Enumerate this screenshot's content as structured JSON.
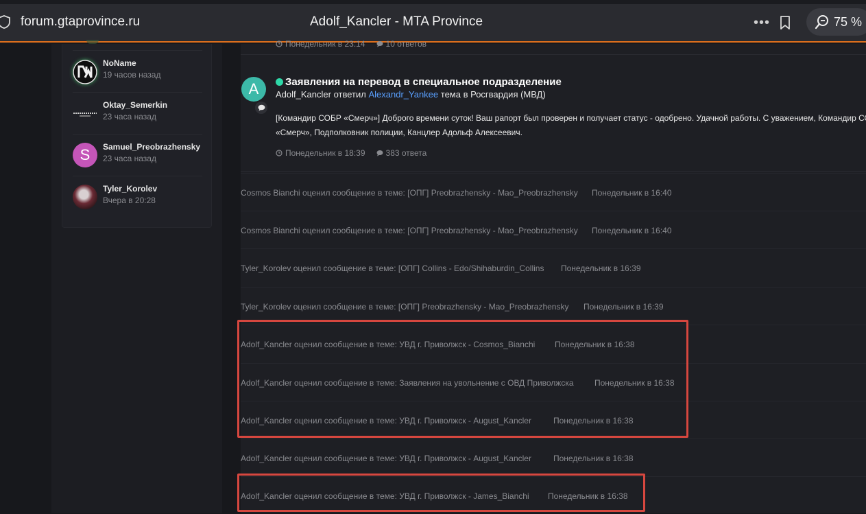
{
  "browser": {
    "url": "forum.gtaprovince.ru",
    "title": "Adolf_Kancler - MTA Province",
    "more": "•••",
    "zoom": "75 %"
  },
  "sidebar": {
    "users": [
      {
        "name": "NoName",
        "time": "19 часов назад"
      },
      {
        "name": "Oktay_Semerkin",
        "time": "23 часа назад"
      },
      {
        "name": "Samuel_Preobrazhensky",
        "time": "23 часа назад",
        "initial": "S"
      },
      {
        "name": "Tyler_Korolev",
        "time": "Вчера в 20:28"
      }
    ]
  },
  "main": {
    "top_meta": {
      "time": "Понедельник в 23:14",
      "replies": "10 ответов"
    },
    "post": {
      "avatar_letter": "A",
      "title": "Заявления на перевод в специальное подразделение",
      "author": "Adolf_Kancler",
      "replied_word": "ответил",
      "target": "Alexandr_Yankee",
      "topic_in": "тема в Росгвардия (МВД)",
      "body_line1": "[Командир СОБР «Смерч»] Доброго времени суток! Ваш рапорт был проверен и получает статус - одобрено. Удачной работы. С уважением, Командир СОБР",
      "body_line2": "«Смерч», Подполковник полиции, Канцлер Адольф Алексеевич.",
      "time": "Понедельник в 18:39",
      "replies": "383 ответа"
    },
    "activity": [
      {
        "text": "Cosmos Bianchi оценил сообщение в теме: [ОПГ] Preobrazhensky - Mao_Preobrazhensky",
        "time": "Понедельник в 16:40"
      },
      {
        "text": "Cosmos Bianchi оценил сообщение в теме: [ОПГ] Preobrazhensky - Mao_Preobrazhensky",
        "time": "Понедельник в 16:40"
      },
      {
        "text": "Tyler_Korolev оценил сообщение в теме: [ОПГ] Collins - Edo/Shihaburdin_Collins",
        "time": "Понедельник в 16:39"
      },
      {
        "text": "Tyler_Korolev оценил сообщение в теме: [ОПГ] Preobrazhensky - Mao_Preobrazhensky",
        "time": "Понедельник в 16:39"
      },
      {
        "text": "Adolf_Kancler оценил сообщение в теме: УВД г. Приволжск - Cosmos_Bianchi",
        "time": "Понедельник в 16:38"
      },
      {
        "text": "Adolf_Kancler оценил сообщение в теме: Заявления на увольнение с ОВД Приволжска",
        "time": "Понедельник в 16:38"
      },
      {
        "text": "Adolf_Kancler оценил сообщение в теме: УВД г. Приволжск - August_Kancler",
        "time": "Понедельник в 16:38"
      },
      {
        "text": "Adolf_Kancler оценил сообщение в теме: УВД г. Приволжск - August_Kancler",
        "time": "Понедельник в 16:38"
      },
      {
        "text": "Adolf_Kancler оценил сообщение в теме: УВД г. Приволжск - James_Bianchi",
        "time": "Понедельник в 16:38"
      }
    ]
  },
  "colors": {
    "accent_bar": "#e0701c",
    "highlight": "#d6473f",
    "link": "#5aa0ff",
    "online": "#2ed8a8"
  }
}
